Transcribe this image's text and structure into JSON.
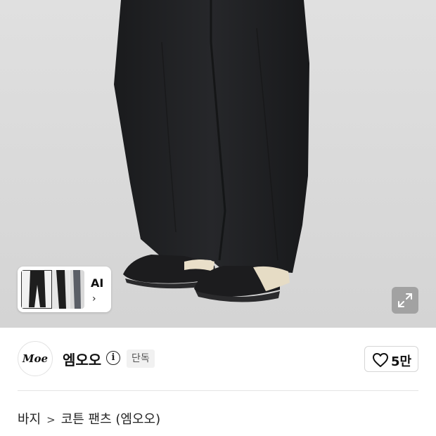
{
  "photo": {
    "thumbnail_label": "AI",
    "thumbnail_arrow": "›",
    "expand_icon": "expand-icon"
  },
  "brand": {
    "logo_text": "Moe",
    "name": "엠오오",
    "info_icon": "i",
    "badge": "단독"
  },
  "like": {
    "count": "5만",
    "icon": "heart-outline-icon"
  },
  "breadcrumb": {
    "category": "바지",
    "separator": ">",
    "product": "코튼 팬츠 (엠오오)"
  }
}
